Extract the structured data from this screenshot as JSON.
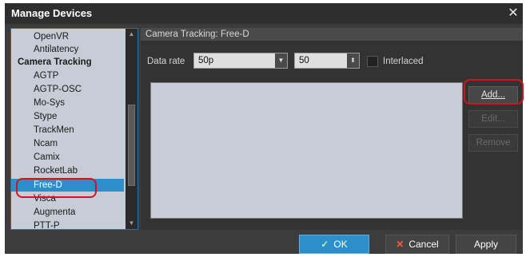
{
  "window": {
    "title": "Manage Devices",
    "close_glyph": "✕"
  },
  "device_list": {
    "items": [
      {
        "label": "OpenVR",
        "type": "item"
      },
      {
        "label": "Antilatency",
        "type": "item"
      },
      {
        "label": "Camera Tracking",
        "type": "category"
      },
      {
        "label": "AGTP",
        "type": "item"
      },
      {
        "label": "AGTP-OSC",
        "type": "item"
      },
      {
        "label": "Mo-Sys",
        "type": "item"
      },
      {
        "label": "Stype",
        "type": "item"
      },
      {
        "label": "TrackMen",
        "type": "item"
      },
      {
        "label": "Ncam",
        "type": "item"
      },
      {
        "label": "Camix",
        "type": "item"
      },
      {
        "label": "RocketLab",
        "type": "item"
      },
      {
        "label": "Free-D",
        "type": "item",
        "selected": true
      },
      {
        "label": "Visca",
        "type": "item"
      },
      {
        "label": "Augmenta",
        "type": "item"
      },
      {
        "label": "PTT-P",
        "type": "item"
      }
    ]
  },
  "detail": {
    "section_title": "Camera Tracking: Free-D",
    "data_rate_label": "Data rate",
    "data_rate_value": "50p",
    "rate_number": "50",
    "interlaced_label": "Interlaced",
    "interlaced_checked": false
  },
  "side_buttons": {
    "add": "Add...",
    "edit": "Edit...",
    "remove": "Remove"
  },
  "footer": {
    "ok": "OK",
    "cancel": "Cancel",
    "apply": "Apply"
  },
  "icons": {
    "ok": "checkmark-icon",
    "cancel": "x-icon"
  },
  "colors": {
    "selection": "#2d8fc9",
    "highlight": "#d8101a"
  }
}
